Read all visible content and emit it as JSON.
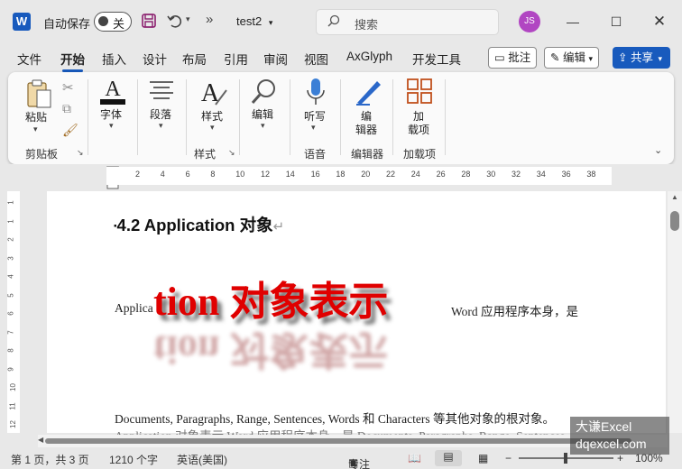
{
  "titlebar": {
    "app_logo": "W",
    "autosave_label": "自动保存",
    "autosave_state": "关",
    "doc_title": "test2",
    "search_placeholder": "搜索",
    "user_initials": "JS"
  },
  "tabs": [
    "文件",
    "开始",
    "插入",
    "设计",
    "布局",
    "引用",
    "审阅",
    "视图",
    "AxGlyph",
    "开发工具"
  ],
  "active_tab": "开始",
  "right_buttons": {
    "comments": "批注",
    "editing": "编辑",
    "share": "共享"
  },
  "ribbon": {
    "paste": "粘贴",
    "font": "字体",
    "paragraph": "段落",
    "styles": "样式",
    "editing": "编辑",
    "dictate": "听写",
    "editor_1": "编",
    "editor_2": "辑器",
    "addins_1": "加",
    "addins_2": "载项",
    "groups": {
      "clipboard": "剪贴板",
      "styles": "样式",
      "voice": "语音",
      "editor": "编辑器",
      "addins": "加载项"
    }
  },
  "ruler_ticks": [
    "2",
    "4",
    "6",
    "8",
    "10",
    "12",
    "14",
    "16",
    "18",
    "20",
    "22",
    "24",
    "26",
    "28",
    "30",
    "32",
    "34",
    "36",
    "38"
  ],
  "vruler_ticks": [
    "1",
    "1",
    "2",
    "3",
    "4",
    "5",
    "6",
    "7",
    "8",
    "9",
    "10",
    "11",
    "12"
  ],
  "document": {
    "heading": "4.2 Application  对象",
    "line1_start": "Applica",
    "wordart": "tion 对象表示",
    "line1_end": "Word 应用程序本身，是",
    "line2": "Documents, Paragraphs, Range, Sentences, Words 和 Characters 等其他对象的根对象。",
    "line3": "Application 对象表示 Word 应用程序本身，是 Documents, Paragraphs, Range, Sentences"
  },
  "statusbar": {
    "page": "第 1 页，共 3 页",
    "words": "1210 个字",
    "lang": "英语(美国)",
    "focus": "专注",
    "zoom": "100%"
  },
  "watermark": {
    "line1": "大谦Excel",
    "line2": "dqexcel.com"
  },
  "colors": {
    "accent": "#185abd",
    "wordart": "#e00000",
    "avatar": "#b146c2"
  }
}
